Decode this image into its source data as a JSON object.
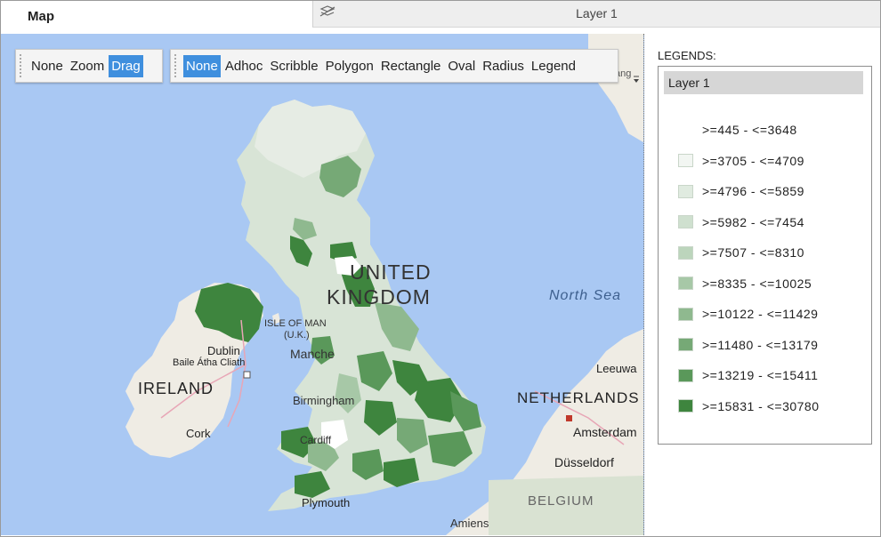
{
  "header": {
    "map_tab_label": "Map",
    "layer_title": "Layer 1"
  },
  "toolbar": {
    "mode_buttons": [
      {
        "label": "None",
        "active": false
      },
      {
        "label": "Zoom",
        "active": false
      },
      {
        "label": "Drag",
        "active": true
      }
    ],
    "selection_buttons": [
      {
        "label": "None",
        "active": true
      },
      {
        "label": "Adhoc",
        "active": false
      },
      {
        "label": "Scribble",
        "active": false
      },
      {
        "label": "Polygon",
        "active": false
      },
      {
        "label": "Rectangle",
        "active": false
      },
      {
        "label": "Oval",
        "active": false
      },
      {
        "label": "Radius",
        "active": false
      },
      {
        "label": "Legend",
        "active": false
      }
    ]
  },
  "map": {
    "labels": {
      "united_line1": "UNITED",
      "united_line2": "KINGDOM",
      "north_sea": "North Sea",
      "isle_of_man_line1": "ISLE OF MAN",
      "isle_of_man_line2": "(U.K.)",
      "dublin": "Dublin",
      "baile_atha_cliath": "Baile Átha Cliath",
      "ireland": "IRELAND",
      "manchester": "Manche",
      "birmingham": "Birmingham",
      "cardiff": "Cardiff",
      "cork": "Cork",
      "plymouth": "Plymouth",
      "netherlands": "NETHERLANDS",
      "amsterdam": "Amsterdam",
      "leeuwarden": "Leeuwa",
      "dusseldorf": "Düsseldorf",
      "belgium": "BELGIUM",
      "amiens": "Amiens",
      "stavanger": "Stavang"
    }
  },
  "legend": {
    "title": "LEGENDS:",
    "layer_name": "Layer 1",
    "items": [
      {
        "label": ">=445 - <=3648",
        "color": "#ffffff"
      },
      {
        "label": ">=3705 - <=4709",
        "color": "#f2f6f2"
      },
      {
        "label": ">=4796 - <=5859",
        "color": "#e0ebe0"
      },
      {
        "label": ">=5982 - <=7454",
        "color": "#cfe0cf"
      },
      {
        "label": ">=7507 - <=8310",
        "color": "#bcd5bc"
      },
      {
        "label": ">=8335 - <=10025",
        "color": "#a7c8a7"
      },
      {
        "label": ">=10122 - <=11429",
        "color": "#8fb98f"
      },
      {
        "label": ">=11480 - <=13179",
        "color": "#76a976"
      },
      {
        "label": ">=13219 - <=15411",
        "color": "#5a985a"
      },
      {
        "label": ">=15831 - <=30780",
        "color": "#3e853e"
      }
    ]
  }
}
